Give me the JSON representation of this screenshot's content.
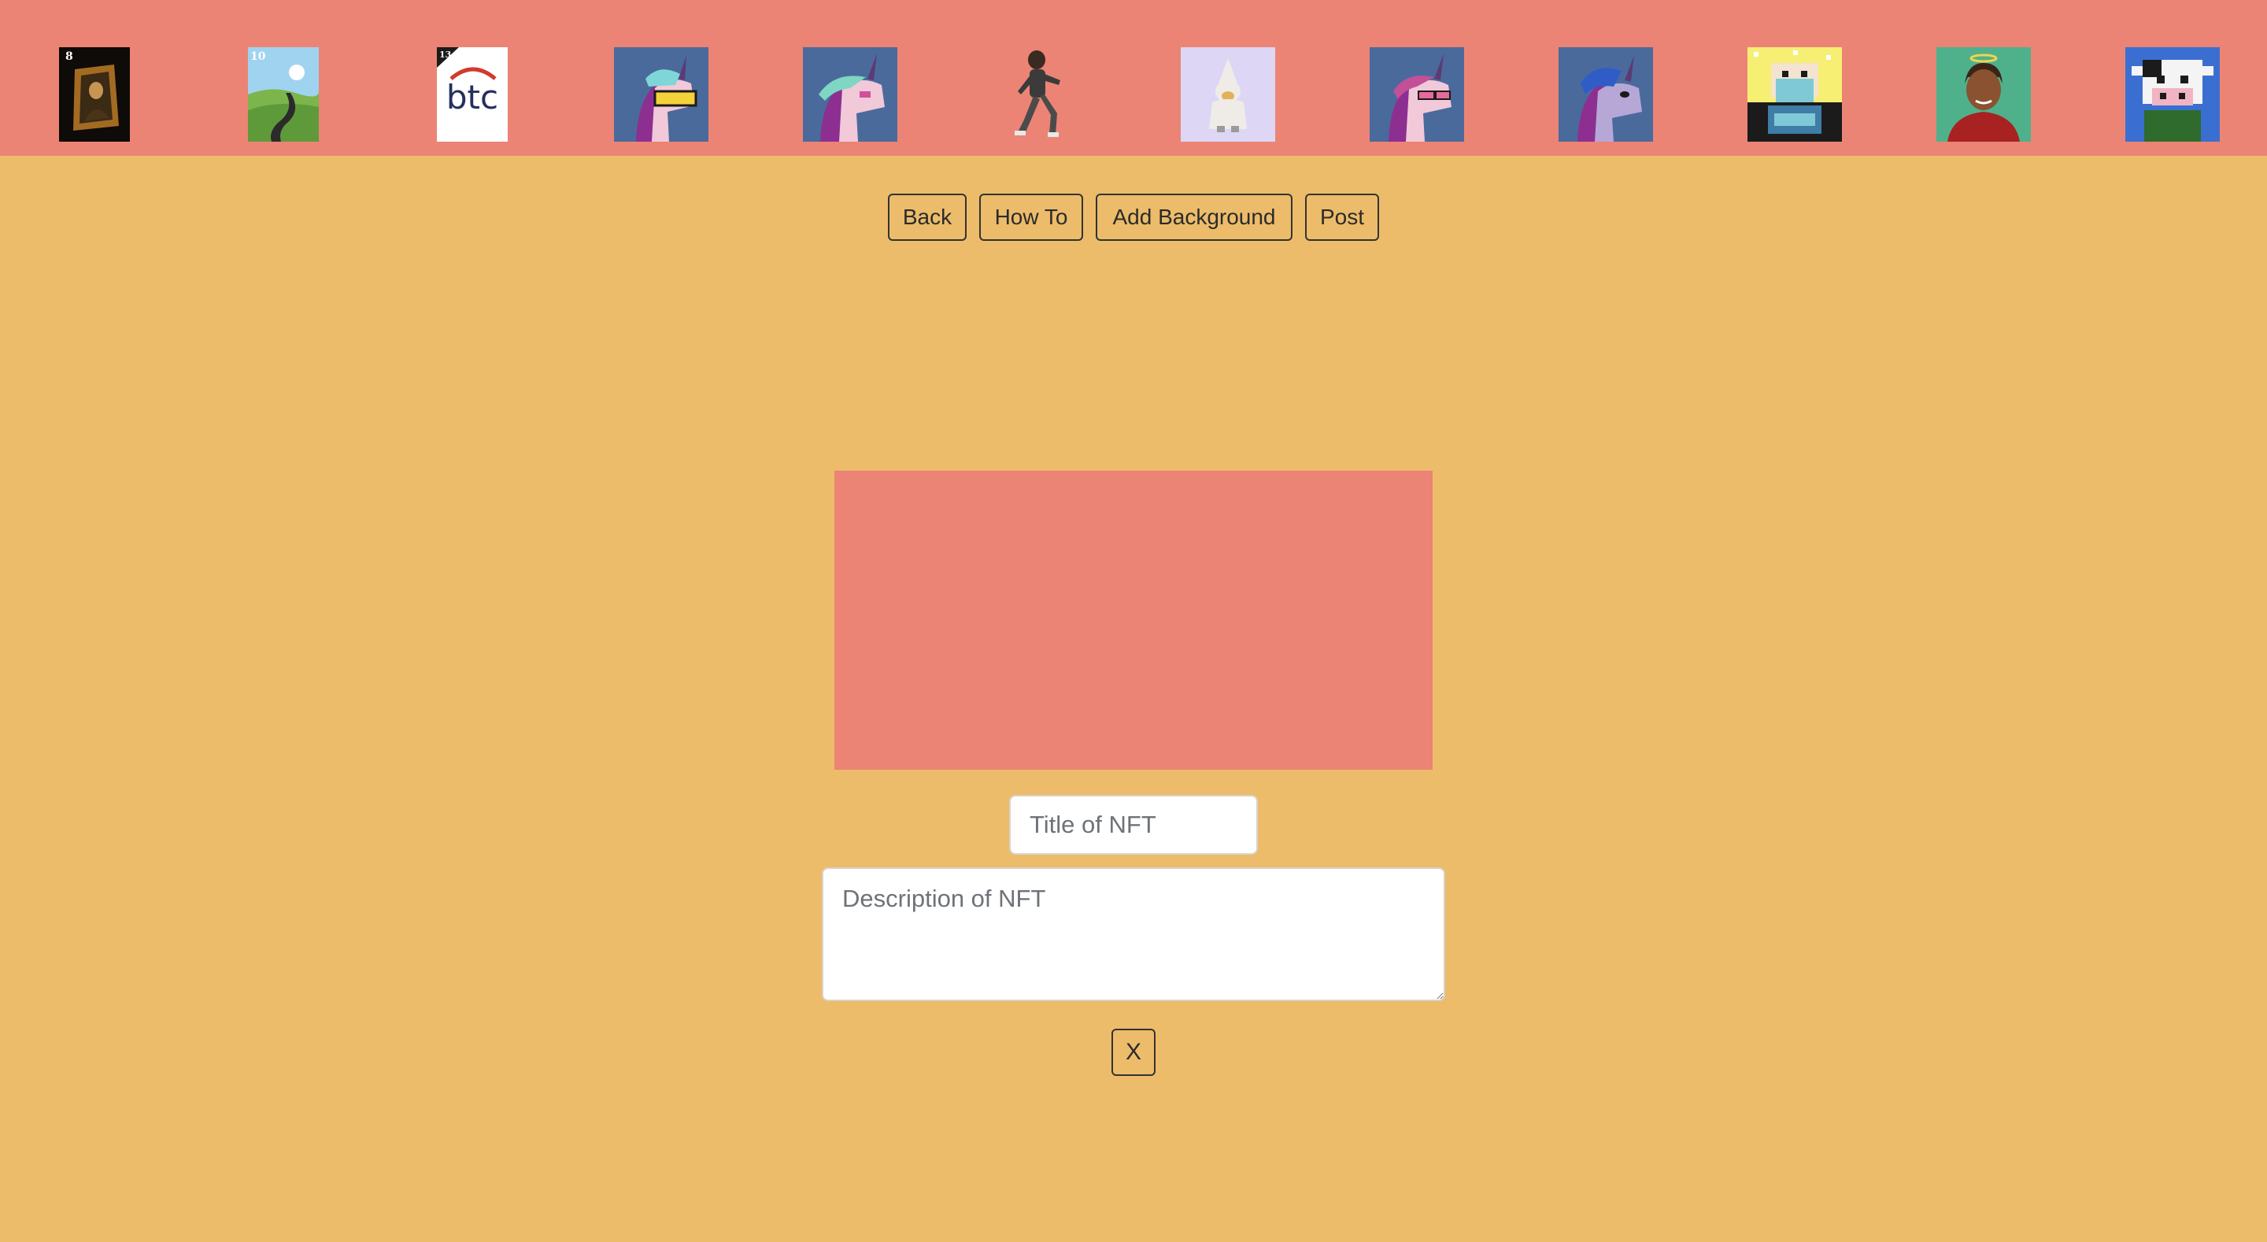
{
  "gallery": {
    "items": [
      {
        "name": "mona-lisa-frame",
        "badge": "8",
        "colors": {
          "bg": "#0e0b08",
          "frame": "#a36b22",
          "figure": "#4a3418"
        }
      },
      {
        "name": "green-hills-road",
        "badge": "10",
        "colors": {
          "sky": "#9fd3f0",
          "hill": "#5f9a3a",
          "road": "#2b2b2b"
        }
      },
      {
        "name": "btc-logo",
        "badge": "13",
        "text": "btc",
        "colors": {
          "bg": "#ffffff",
          "text": "#24315e",
          "arc": "#d23a2e"
        }
      },
      {
        "name": "unicorn-visor",
        "colors": {
          "bg": "#4a6a9c",
          "mane": "#8d2f91",
          "visor": "#f3d23a"
        }
      },
      {
        "name": "unicorn-teal-mane",
        "colors": {
          "bg": "#4a6a9c",
          "mane": "#7fd6c2",
          "body": "#f1c9d8"
        }
      },
      {
        "name": "running-boy",
        "colors": {
          "bg": "#eb8475",
          "body": "#3b3b3b"
        }
      },
      {
        "name": "white-wizard-bear",
        "colors": {
          "bg": "#ddd6f5",
          "body": "#efece7"
        }
      },
      {
        "name": "unicorn-pink-shades",
        "colors": {
          "bg": "#4a6a9c",
          "mane": "#8d2f91",
          "shades": "#e86a9c"
        }
      },
      {
        "name": "unicorn-blue-mane",
        "colors": {
          "bg": "#4a6a9c",
          "mane": "#2f5cc7",
          "body": "#b6a7d6"
        }
      },
      {
        "name": "pixel-robot-sparkle",
        "colors": {
          "bg": "#f6ef74",
          "body": "#7fc9d6"
        }
      },
      {
        "name": "man-halo-red-hoodie",
        "colors": {
          "bg": "#4fb18b",
          "hoodie": "#a82222",
          "halo": "#f1d54a"
        }
      },
      {
        "name": "pixel-cow",
        "colors": {
          "bg": "#3a6fd1",
          "body": "#f4f4f4",
          "shirt": "#2f6b2c"
        }
      }
    ]
  },
  "toolbar": {
    "back_label": "Back",
    "howto_label": "How To",
    "addbg_label": "Add Background",
    "post_label": "Post"
  },
  "editor": {
    "canvas_color": "#eb8475",
    "title_placeholder": "Title of NFT",
    "desc_placeholder": "Description of NFT",
    "close_label": "X"
  },
  "theme": {
    "page_bg": "#ecbc6a",
    "topbar_bg": "#eb8475"
  }
}
